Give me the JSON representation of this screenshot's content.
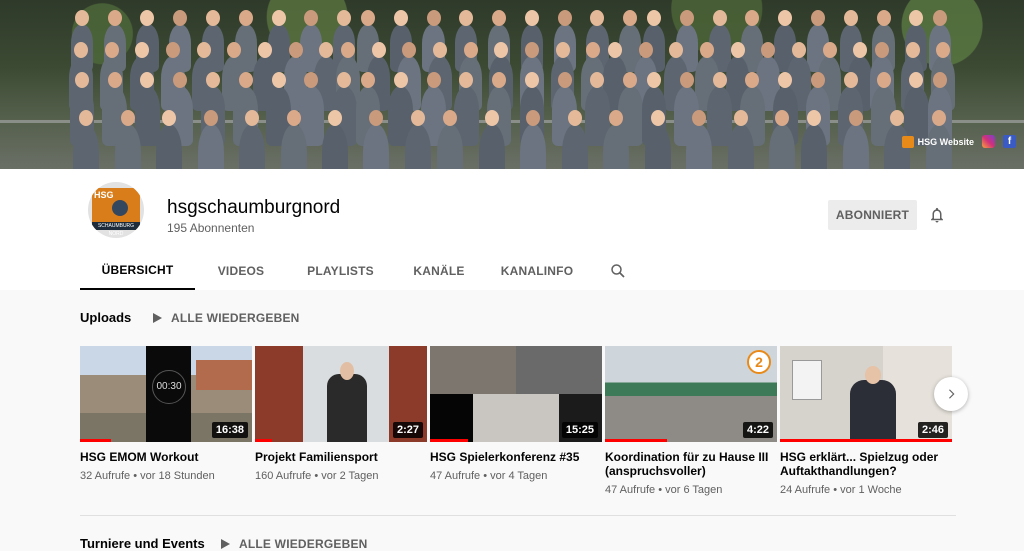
{
  "banner": {
    "website_label": "HSG Website",
    "links": [
      "website-link",
      "instagram-link",
      "facebook-link"
    ]
  },
  "channel": {
    "name": "hsgschaumburgnord",
    "subscribers": "195 Abonnenten",
    "subscribe_label": "ABONNIERT",
    "avatar_text_top": "HSG",
    "avatar_text_bottom": "SCHAUMBURG NORD"
  },
  "tabs": [
    "ÜBERSICHT",
    "VIDEOS",
    "PLAYLISTS",
    "KANÄLE",
    "KANALINFO"
  ],
  "active_tab": "ÜBERSICHT",
  "uploads": {
    "title": "Uploads",
    "play_all": "ALLE WIEDERGEBEN",
    "videos": [
      {
        "title": "HSG EMOM Workout",
        "duration": "16:38",
        "views": "32 Aufrufe",
        "age": "vor 18 Stunden",
        "thumb_text": "00:30",
        "progress": 0.18
      },
      {
        "title": "Projekt Familiensport",
        "duration": "2:27",
        "views": "160 Aufrufe",
        "age": "vor 2 Tagen",
        "progress": 0.1
      },
      {
        "title": "HSG Spielerkonferenz #35",
        "duration": "15:25",
        "views": "47 Aufrufe",
        "age": "vor 4 Tagen",
        "progress": 0.22
      },
      {
        "title": "Koordination für zu Hause III (anspruchsvoller)",
        "duration": "4:22",
        "views": "47 Aufrufe",
        "age": "vor 6 Tagen",
        "thumb_text": "2",
        "progress": 0.36
      },
      {
        "title": "HSG erklärt... Spielzug oder Auftakthandlungen?",
        "duration": "2:46",
        "views": "24 Aufrufe",
        "age": "vor 1 Woche",
        "progress": 1.0
      }
    ]
  },
  "section2": {
    "title": "Turniere und Events",
    "play_all": "ALLE WIEDERGEBEN"
  },
  "colors": {
    "accent": "#ff0000",
    "brand_orange": "#d97d1a"
  }
}
